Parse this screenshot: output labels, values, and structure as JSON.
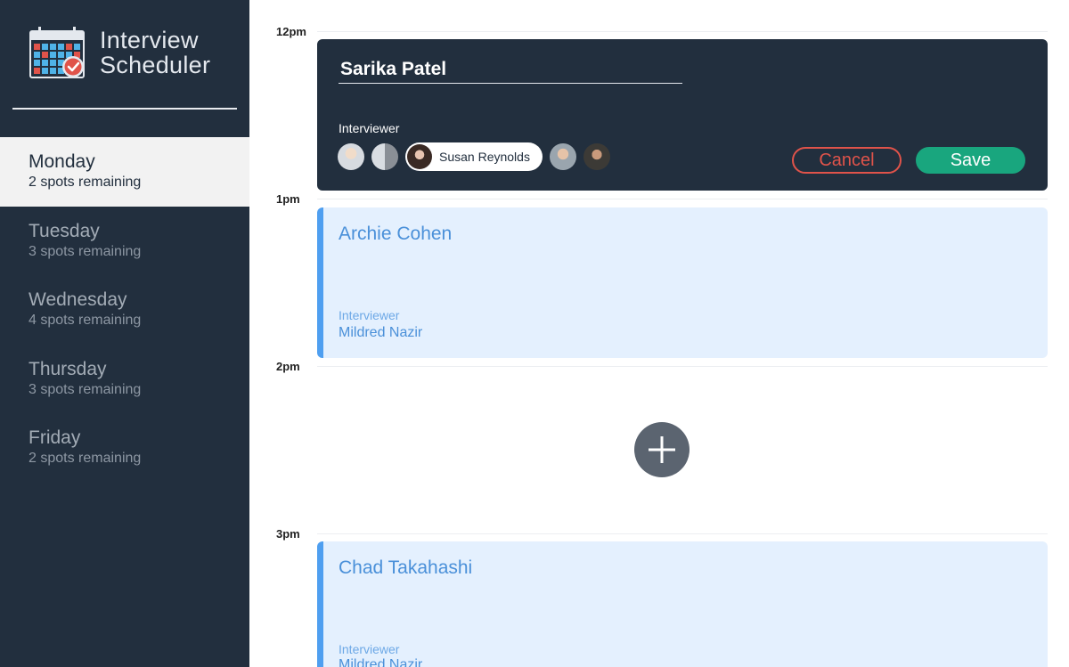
{
  "app": {
    "title_line1": "Interview",
    "title_line2": "Scheduler"
  },
  "sidebar": {
    "days": [
      {
        "name": "Monday",
        "spots": "2 spots remaining",
        "selected": true
      },
      {
        "name": "Tuesday",
        "spots": "3 spots remaining",
        "selected": false
      },
      {
        "name": "Wednesday",
        "spots": "4 spots remaining",
        "selected": false
      },
      {
        "name": "Thursday",
        "spots": "3 spots remaining",
        "selected": false
      },
      {
        "name": "Friday",
        "spots": "2 spots remaining",
        "selected": false
      }
    ]
  },
  "schedule": {
    "times": [
      "12pm",
      "1pm",
      "2pm",
      "3pm"
    ],
    "form": {
      "student_value": "Sarika Patel",
      "interviewer_label": "Interviewer",
      "selected_interviewer": "Susan Reynolds",
      "cancel_label": "Cancel",
      "save_label": "Save"
    },
    "appointments": [
      {
        "student": "Archie Cohen",
        "interviewer_label": "Interviewer",
        "interviewer": "Mildred Nazir"
      },
      {
        "student": "Chad Takahashi",
        "interviewer_label": "Interviewer",
        "interviewer": "Mildred Nazir"
      }
    ]
  },
  "colors": {
    "sidebar_bg": "#222f3e",
    "selected_day_bg": "#f2f2f2",
    "appointment_bg": "#e4f0fe",
    "appointment_accent": "#4f9ff0",
    "cancel": "#e0534a",
    "save": "#19a67e",
    "add_button": "#5b6470"
  },
  "icons": {
    "logo": "calendar-check-icon",
    "add": "plus-icon"
  }
}
